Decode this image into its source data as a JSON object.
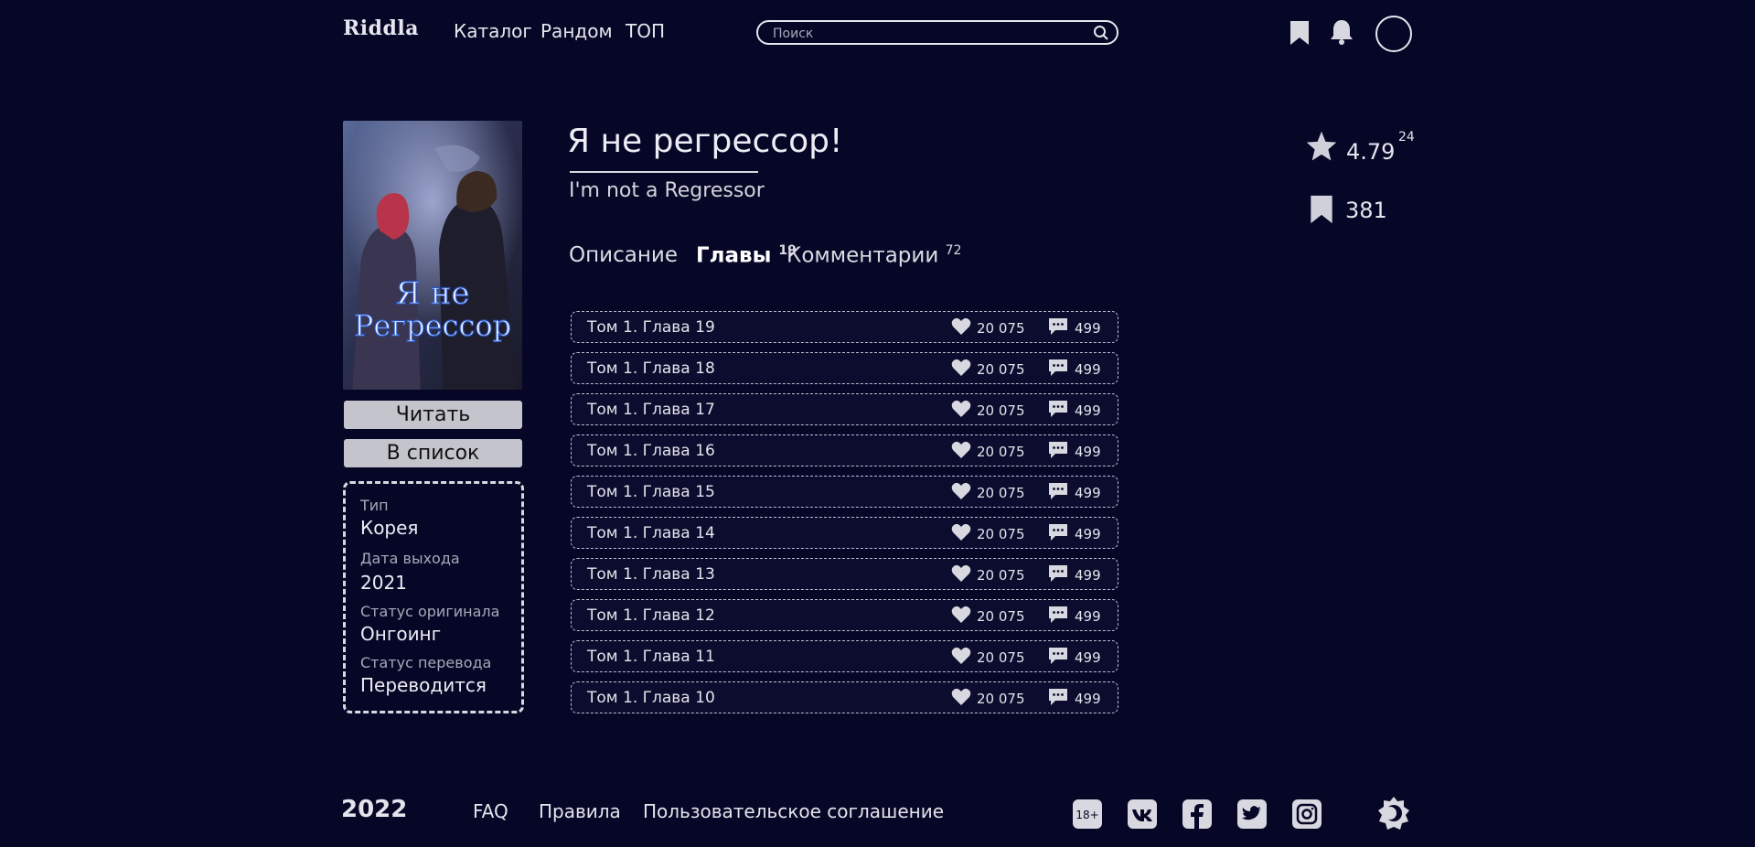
{
  "header": {
    "logo": "Riddla",
    "nav": [
      "Каталог",
      "Рандом",
      "ТОП"
    ],
    "search_placeholder": "Поиск"
  },
  "title": {
    "main": "Я не регрессор!",
    "original": "I'm not a Regressor",
    "cover_text_line1": "Я не",
    "cover_text_line2": "Регрессор"
  },
  "tabs": [
    {
      "label": "Описание",
      "count": ""
    },
    {
      "label": "Главы",
      "count": "19"
    },
    {
      "label": "Комментарии",
      "count": "72"
    }
  ],
  "actions": {
    "read": "Читать",
    "add_list": "В список"
  },
  "info": [
    {
      "label": "Тип",
      "value": "Корея"
    },
    {
      "label": "Дата выхода",
      "value": "2021"
    },
    {
      "label": "Статус оригинала",
      "value": "Онгоинг"
    },
    {
      "label": "Статус перевода",
      "value": "Переводится"
    }
  ],
  "stats": {
    "rating": "4.79",
    "rating_votes": "24",
    "bookmarks": "381"
  },
  "chapters": [
    {
      "name": "Том 1. Глава 19",
      "likes": "20 075",
      "comments": "499"
    },
    {
      "name": "Том 1. Глава 18",
      "likes": "20 075",
      "comments": "499"
    },
    {
      "name": "Том 1. Глава 17",
      "likes": "20 075",
      "comments": "499"
    },
    {
      "name": "Том 1. Глава 16",
      "likes": "20 075",
      "comments": "499"
    },
    {
      "name": "Том 1. Глава 15",
      "likes": "20 075",
      "comments": "499"
    },
    {
      "name": "Том 1. Глава 14",
      "likes": "20 075",
      "comments": "499"
    },
    {
      "name": "Том 1. Глава 13",
      "likes": "20 075",
      "comments": "499"
    },
    {
      "name": "Том 1. Глава 12",
      "likes": "20 075",
      "comments": "499"
    },
    {
      "name": "Том 1. Глава 11",
      "likes": "20 075",
      "comments": "499"
    },
    {
      "name": "Том 1. Глава 10",
      "likes": "20 075",
      "comments": "499"
    }
  ],
  "footer": {
    "year": "2022",
    "links": [
      "FAQ",
      "Правила",
      "Пользовательское соглашение"
    ],
    "age_badge": "18+",
    "social_icons": [
      "vk-icon",
      "facebook-icon",
      "twitter-icon",
      "instagram-icon"
    ]
  },
  "colors": {
    "background": "#060727",
    "text": "#e8e8f0",
    "button": "#c4c4cc"
  }
}
